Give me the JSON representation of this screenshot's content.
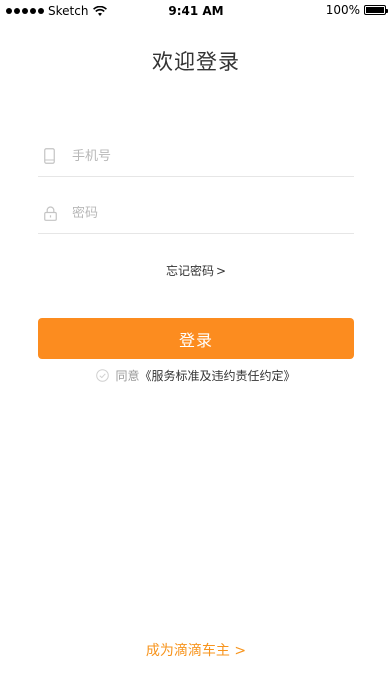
{
  "status_bar": {
    "carrier": "Sketch",
    "time": "9:41 AM",
    "battery": "100%",
    "icons": [
      "signal-dots-icon",
      "wifi-icon",
      "battery-icon"
    ]
  },
  "title": "欢迎登录",
  "phone_field": {
    "placeholder": "手机号",
    "value": "",
    "icon": "phone-icon"
  },
  "password_field": {
    "placeholder": "密码",
    "value": "",
    "icon": "lock-icon"
  },
  "forgot_password": {
    "label": "忘记密码",
    "chevron": ">"
  },
  "login_button": {
    "label": "登录",
    "color": "#fc8c1f"
  },
  "agreement": {
    "prefix": "同意",
    "link": "《服务标准及违约责任约定》",
    "checked": false
  },
  "become_driver": {
    "label": "成为滴滴车主",
    "chevron": ">",
    "color": "#f7941d"
  }
}
